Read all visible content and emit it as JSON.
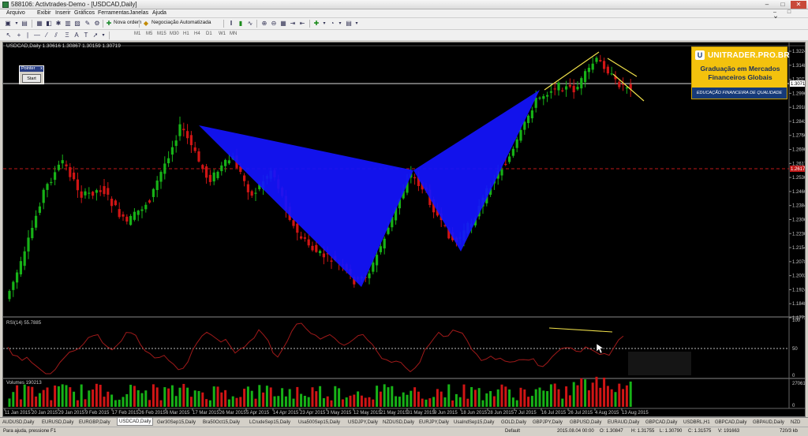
{
  "window": {
    "title": "588106: Activtrades-Demo - [USDCAD,Daily]",
    "minimize": "–",
    "maximize": "□",
    "close": "✕"
  },
  "menu": [
    "Arquivo",
    "Exibir",
    "Inserir",
    "Gráficos",
    "Ferramentas",
    "Janelas",
    "Ajuda"
  ],
  "mdi_controls": "– □ ✕",
  "toolbar": {
    "new_order": "Nova ordem",
    "auto_trading": "Negociação Automatizada",
    "timeframes": [
      "M1",
      "M5",
      "M15",
      "M30",
      "H1",
      "H4",
      "D1",
      "W1",
      "MN"
    ]
  },
  "chart": {
    "label": "USDCAD,Daily  1.30616 1.30867 1.30159 1.30719",
    "rsi_label": "RSI(14) 55.7885",
    "volume_label": "Volumes 190213",
    "price_axis": [
      "1.32240",
      "1.31480",
      "1.30719",
      "1.29960",
      "1.29180",
      "1.28420",
      "1.27660",
      "1.26900",
      "1.26170",
      "1.25360",
      "1.24600",
      "1.23840",
      "1.23060",
      "1.22300",
      "1.21540",
      "1.20780",
      "1.20020",
      "1.19240",
      "1.18480",
      "1.17720"
    ],
    "current_price": "1.30719",
    "alert_price": "1.26170",
    "rsi_axis": [
      "100",
      "50",
      "0"
    ],
    "volume_axis": [
      "270614",
      "0"
    ],
    "dates": [
      "11 Jan 2015",
      "20 Jan 2015",
      "29 Jan 2015",
      "9 Feb 2015",
      "17 Feb 2015",
      "26 Feb 2015",
      "6 Mar 2015",
      "17 Mar 2015",
      "26 Mar 2015",
      "5 Apr 2015",
      "14 Apr 2015",
      "23 Apr 2015",
      "3 May 2015",
      "12 May 2015",
      "21 May 2015",
      "31 May 2015",
      "9 Jun 2015",
      "18 Jun 2015",
      "28 Jun 2015",
      "7 Jul 2015",
      "16 Jul 2015",
      "26 Jul 2015",
      "4 Aug 2015",
      "13 Aug 2015"
    ],
    "pattern_color": "#1414ff",
    "trendline_color": "#f0e04a",
    "bull_color": "#17b217",
    "bear_color": "#d01515",
    "rsi_color": "#a01a1a"
  },
  "pointer_panel": {
    "title": "Pointer",
    "close": "x",
    "button": "Start"
  },
  "ad": {
    "logo": "U",
    "brand": "UNITRADER.PRO.BR",
    "line1": "Graduação em Mercados",
    "line2": "Financeiros Globais",
    "footer": "EDUCAÇÃO FINANCEIRA DE QUALIDADE"
  },
  "tabs": [
    "AUDUSD,Daily",
    "EURUSD,Daily",
    "EURGBP,Daily",
    "USDCAD,Daily",
    "Ger30Sep15,Daily",
    "Bra50Oct15,Daily",
    "LCrudeSep15,Daily",
    "Usa500Sep15,Daily",
    "USDJPY,Daily",
    "NZDUSD,Daily",
    "EURJPY,Daily",
    "UsaIndSep15,Daily",
    "GOLD,Daily",
    "GBPJPY,Daily",
    "GBPUSD,Daily",
    "EURAUD,Daily",
    "GBPCAD,Daily",
    "USDBRL,H1",
    "GBPCAD,Daily",
    "GBPAUD,Daily",
    "NZD"
  ],
  "active_tab": "USDCAD,Daily",
  "status": {
    "help": "Para ajuda, pressione F1",
    "profile": "Default",
    "datetime": "2015.08.04 00:00",
    "open": "O: 1.30847",
    "high": "H: 1.31755",
    "low": "L: 1.30790",
    "close": "C: 1.31575",
    "volume": "V: 191663",
    "traffic": "720/3 kb"
  }
}
